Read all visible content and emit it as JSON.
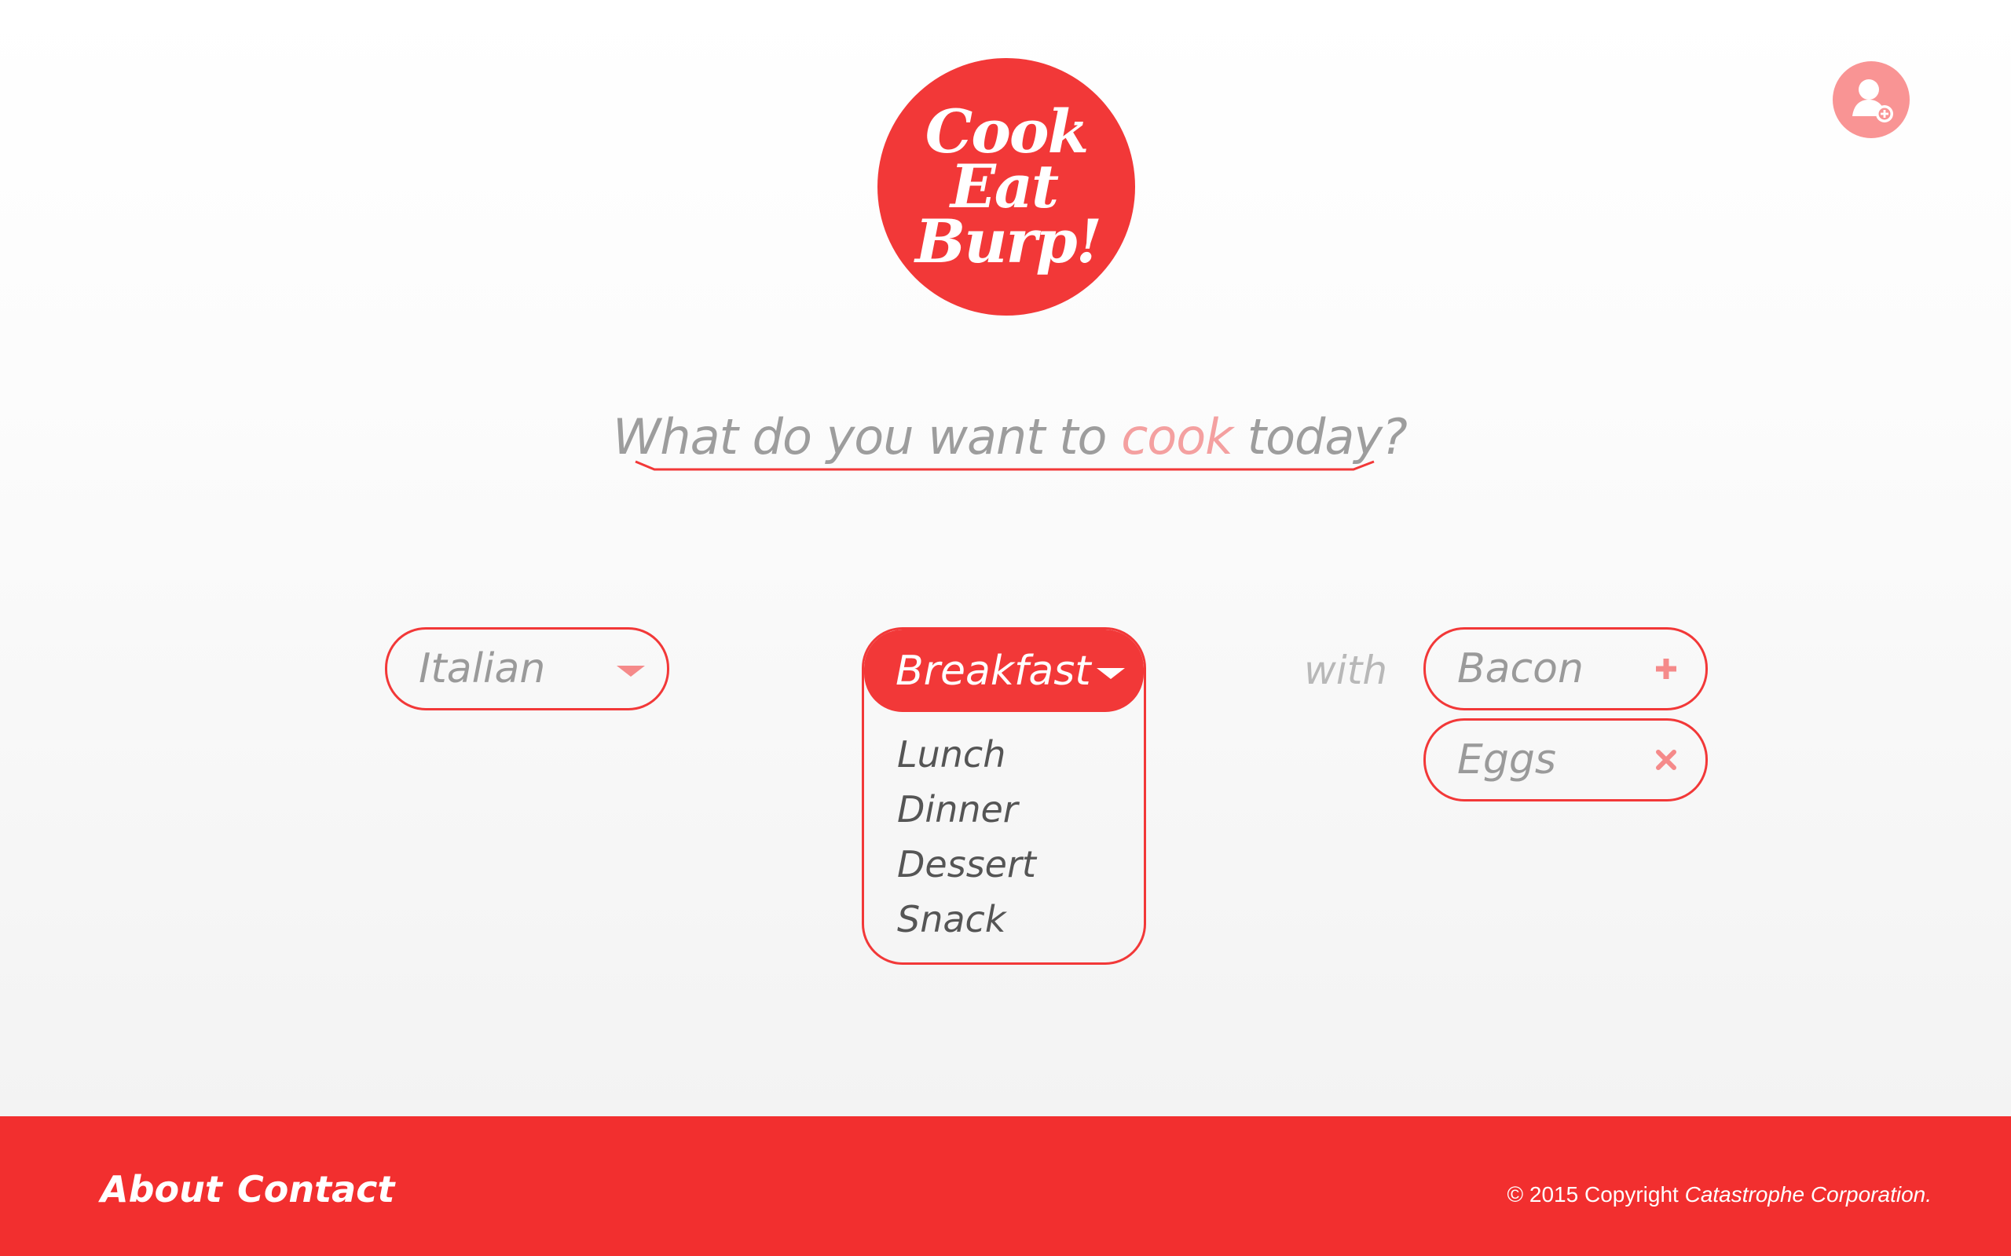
{
  "logo": {
    "line1": "Cook",
    "line2": "Eat",
    "line3": "Burp!"
  },
  "header": {
    "add_user_icon": "add-user-icon"
  },
  "question": {
    "before": "What do you want to ",
    "highlight": "cook",
    "after": " today?"
  },
  "colors": {
    "brand": "#f23838",
    "accent_light": "#f99494",
    "muted_text": "#9a9a9a"
  },
  "cuisine": {
    "selected": "Italian"
  },
  "meal": {
    "selected": "Breakfast",
    "options": [
      "Lunch",
      "Dinner",
      "Dessert",
      "Snack"
    ]
  },
  "with_label": "with",
  "ingredients": [
    {
      "label": "Bacon",
      "action": "add"
    },
    {
      "label": "Eggs",
      "action": "remove"
    }
  ],
  "footer": {
    "links": [
      "About",
      "Contact"
    ],
    "copyright_prefix": "© 2015 Copyright ",
    "copyright_company": "Catastrophe Corporation."
  }
}
